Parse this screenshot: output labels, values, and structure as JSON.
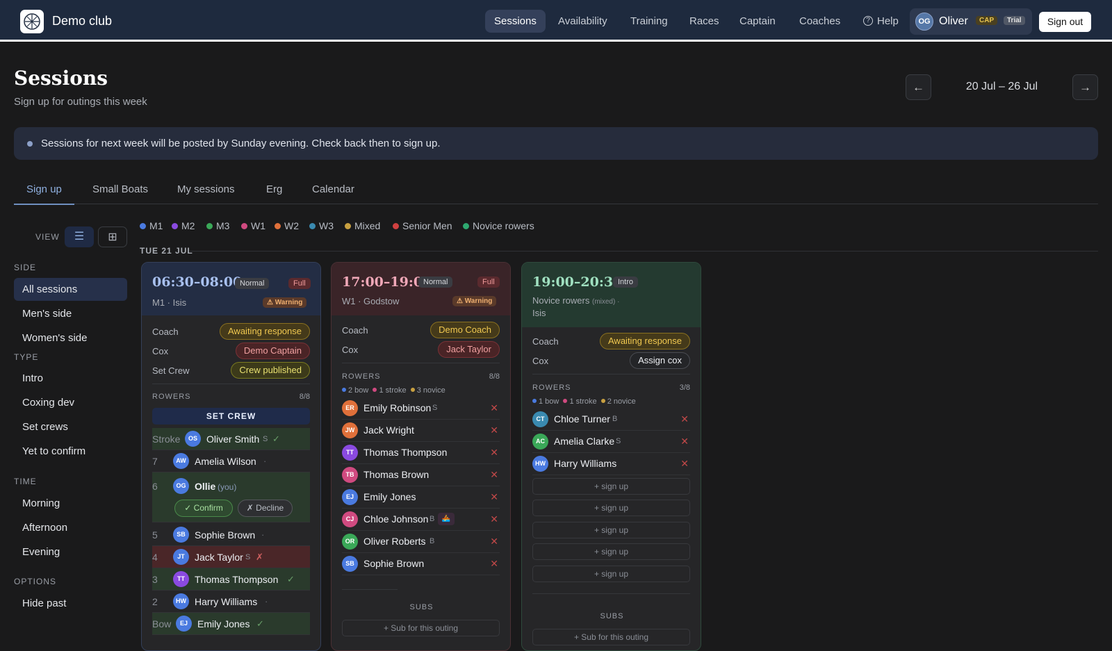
{
  "app": {
    "club_name": "Demo club",
    "nav": [
      "Sessions",
      "Availability",
      "Training",
      "Races",
      "Captain",
      "Coaches",
      "Help"
    ],
    "user": {
      "initials": "OG",
      "name": "Oliver",
      "badges": [
        "CAP",
        "Trial"
      ]
    },
    "sign_out": "Sign out"
  },
  "page": {
    "title": "Sessions",
    "subtitle": "Sign up for outings this week",
    "date_range": "20 Jul – 26 Jul",
    "prev": "←",
    "next": "→"
  },
  "banner": "Sessions for next week will be posted by Sunday evening. Check back then to sign up.",
  "tabs": [
    "Sign up",
    "Small Boats",
    "My sessions",
    "Erg",
    "Calendar"
  ],
  "view_label": "VIEW",
  "filters": {
    "side_label": "SIDE",
    "side": [
      "All sessions",
      "Men's side",
      "Women's side"
    ],
    "type_label": "TYPE",
    "type": [
      "Intro",
      "Coxing dev",
      "Set crews",
      "Yet to confirm"
    ],
    "time_label": "TIME",
    "time": [
      "Morning",
      "Afternoon",
      "Evening"
    ],
    "options_label": "OPTIONS",
    "options": [
      "Hide past"
    ]
  },
  "legend": [
    {
      "label": "M1",
      "color": "#4a7ae0"
    },
    {
      "label": "M2",
      "color": "#8a4ae0"
    },
    {
      "label": "M3",
      "color": "#3aa858"
    },
    {
      "label": "W1",
      "color": "#d04a80"
    },
    {
      "label": "W2",
      "color": "#e0703a"
    },
    {
      "label": "W3",
      "color": "#3a8ab0"
    },
    {
      "label": "Mixed",
      "color": "#c8a040"
    },
    {
      "label": "Senior Men",
      "color": "#d04040"
    },
    {
      "label": "Novice rowers",
      "color": "#2ea870"
    }
  ],
  "day_label": "TUE 21 JUL",
  "cards": [
    {
      "time": "06:30–08:00",
      "type": "Normal",
      "status": "Full",
      "subtitle": "M1 · Isis",
      "warning": "⚠ Warning",
      "roles": [
        {
          "label": "Coach",
          "value": "Awaiting response"
        },
        {
          "label": "Cox",
          "value": "Demo Captain"
        },
        {
          "label": "Set Crew",
          "value": "Crew published"
        }
      ],
      "rowers_label": "ROWERS",
      "rowers_count": "8/8",
      "set_crew": "SET CREW",
      "rowers": [
        {
          "pos": "Stroke",
          "initials": "OS",
          "name": "Oliver Smith",
          "side": "S",
          "mark": "✓"
        },
        {
          "pos": "7",
          "initials": "AW",
          "name": "Amelia Wilson",
          "side": "",
          "mark": "·"
        },
        {
          "pos": "6",
          "initials": "OG",
          "name": "Ollie",
          "you": "(you)",
          "confirm": "✓ Confirm",
          "decline": "✗ Decline"
        },
        {
          "pos": "5",
          "initials": "SB",
          "name": "Sophie Brown",
          "side": "",
          "mark": "·"
        },
        {
          "pos": "4",
          "initials": "JT",
          "name": "Jack Taylor",
          "side": "S",
          "mark": "✗"
        },
        {
          "pos": "3",
          "initials": "TT",
          "name": "Thomas Thompson",
          "side": "",
          "mark": "✓"
        },
        {
          "pos": "2",
          "initials": "HW",
          "name": "Harry Williams",
          "side": "",
          "mark": "·"
        },
        {
          "pos": "Bow",
          "initials": "EJ",
          "name": "Emily Jones",
          "side": "",
          "mark": "✓"
        }
      ]
    },
    {
      "time": "17:00–19:00",
      "type": "Normal",
      "status": "Full",
      "subtitle": "W1 · Godstow",
      "warning": "⚠ Warning",
      "roles": [
        {
          "label": "Coach",
          "value": "Demo Coach"
        },
        {
          "label": "Cox",
          "value": "Jack Taylor"
        }
      ],
      "rowers_label": "ROWERS",
      "rowers_count": "8/8",
      "mini": [
        "2 bow",
        "1 stroke",
        "3 novice"
      ],
      "rowers": [
        {
          "initials": "ER",
          "name": "Emily Robinson",
          "side": "S"
        },
        {
          "initials": "JW",
          "name": "Jack Wright",
          "side": ""
        },
        {
          "initials": "TT",
          "name": "Thomas Thompson",
          "side": ""
        },
        {
          "initials": "TB",
          "name": "Thomas Brown",
          "side": ""
        },
        {
          "initials": "EJ",
          "name": "Emily Jones",
          "side": ""
        },
        {
          "initials": "CJ",
          "name": "Chloe Johnson",
          "side": "B"
        },
        {
          "initials": "OR",
          "name": "Oliver Roberts",
          "side": "B"
        },
        {
          "initials": "SB",
          "name": "Sophie Brown",
          "side": ""
        }
      ],
      "subs_label": "SUBS",
      "sub_btn": "+ Sub for this outing"
    },
    {
      "time": "19:00–20:30",
      "type": "Intro",
      "subtitle": "Novice rowers",
      "subtitle_extra": "(mixed) ·",
      "subtitle2": "Isis",
      "roles": [
        {
          "label": "Coach",
          "value": "Awaiting response"
        },
        {
          "label": "Cox",
          "value": "Assign cox"
        }
      ],
      "rowers_label": "ROWERS",
      "rowers_count": "3/8",
      "mini": [
        "1 bow",
        "1 stroke",
        "2 novice"
      ],
      "rowers": [
        {
          "initials": "CT",
          "name": "Chloe Turner",
          "side": "B"
        },
        {
          "initials": "AC",
          "name": "Amelia Clarke",
          "side": "S"
        },
        {
          "initials": "HW",
          "name": "Harry Williams",
          "side": ""
        }
      ],
      "signup": "+ sign up",
      "subs_label": "SUBS",
      "sub_btn": "+ Sub for this outing"
    }
  ]
}
